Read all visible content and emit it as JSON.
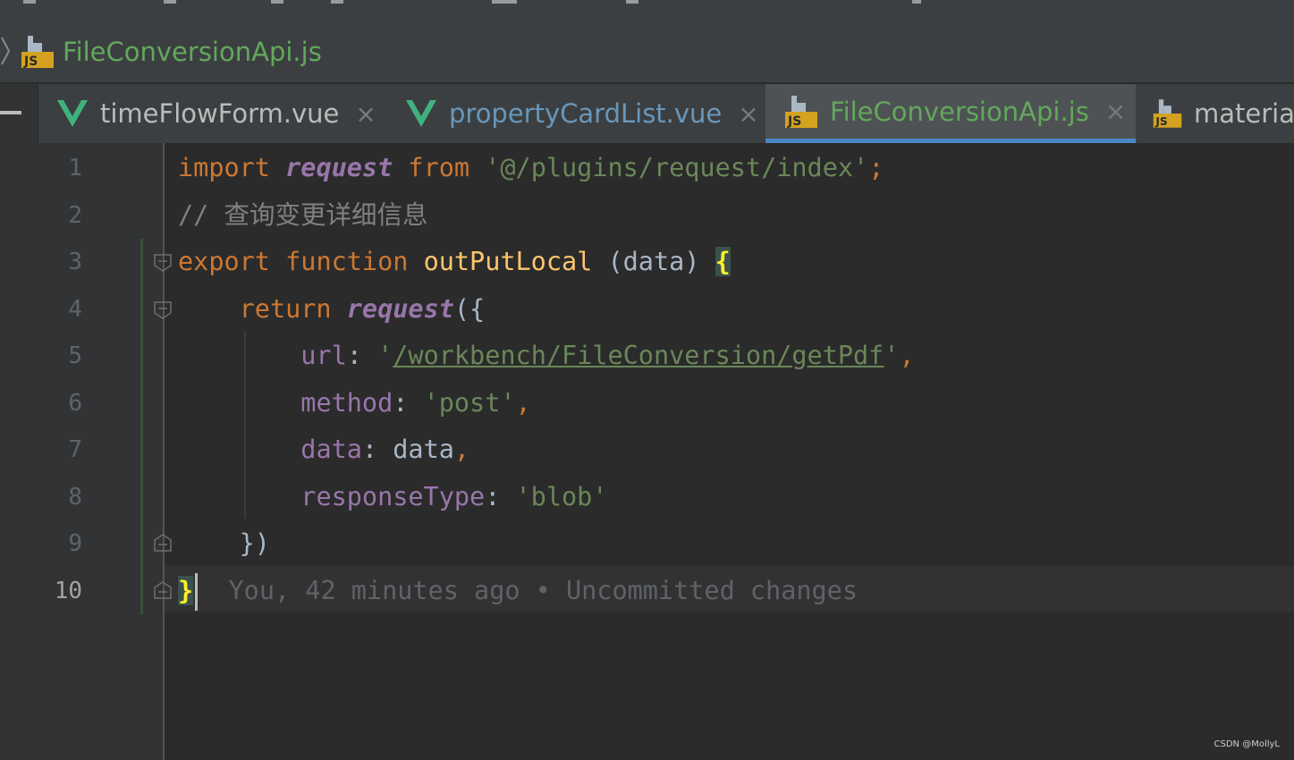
{
  "breadcrumb": {
    "file_icon": "js-file-icon",
    "file_name": "FileConversionApi.js"
  },
  "tabs": [
    {
      "label": "timeFlowForm.vue",
      "icon": "vue-icon",
      "active": false
    },
    {
      "label": "propertyCardList.vue",
      "icon": "vue-icon",
      "active": false
    },
    {
      "label": "FileConversionApi.js",
      "icon": "js-file-icon",
      "active": true
    },
    {
      "label": "materia",
      "icon": "js-file-icon",
      "active": false
    }
  ],
  "tab_close_glyph": "×",
  "editor": {
    "line_numbers": [
      "1",
      "2",
      "3",
      "4",
      "5",
      "6",
      "7",
      "8",
      "9",
      "10"
    ],
    "current_line": 10,
    "lines": {
      "l1": {
        "kw_import": "import",
        "ident": "request",
        "kw_from": "from",
        "str": "'@/plugins/request/index'",
        "semi": ";"
      },
      "l2": {
        "comment": "// 查询变更详细信息"
      },
      "l3": {
        "kw_export": "export",
        "kw_function": "function",
        "fn_name": "outPutLocal",
        "params": " (data) ",
        "brace": "{"
      },
      "l4": {
        "kw_return": "return",
        "ident": "request",
        "punct": "({"
      },
      "l5": {
        "prop": "url",
        "colon": ": ",
        "quote_open": "'",
        "url": "/workbench/FileConversion/getPdf",
        "quote_close": "'",
        "comma": ","
      },
      "l6": {
        "prop": "method",
        "colon": ": ",
        "str": "'post'",
        "comma": ","
      },
      "l7": {
        "prop": "data",
        "colon": ": ",
        "value": "data",
        "comma": ","
      },
      "l8": {
        "prop": "responseType",
        "colon": ": ",
        "str": "'blob'"
      },
      "l9": {
        "punct": "})"
      },
      "l10": {
        "brace": "}",
        "blame": "You, 42 minutes ago • Uncommitted changes"
      }
    }
  },
  "watermark": "CSDN @MollyL",
  "colors": {
    "keyword": "#cc7832",
    "string": "#6a8759",
    "function": "#ffc66d",
    "property": "#9876aa",
    "comment": "#808080",
    "active_tab_underline": "#4a88c7",
    "breadcrumb_text": "#62a85c"
  }
}
